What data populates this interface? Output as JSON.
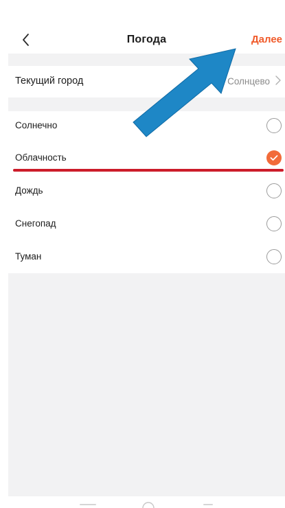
{
  "header": {
    "title": "Погода",
    "next_label": "Далее"
  },
  "city": {
    "label": "Текущий город",
    "value": "Солнцево"
  },
  "options": [
    {
      "label": "Солнечно",
      "checked": false
    },
    {
      "label": "Облачность",
      "checked": true
    },
    {
      "label": "Дождь",
      "checked": false
    },
    {
      "label": "Снегопад",
      "checked": false
    },
    {
      "label": "Туман",
      "checked": false
    }
  ],
  "colors": {
    "accent": "#f05a2a",
    "checked_radio": "#f26b3a",
    "annotation_arrow": "#1e87c6",
    "annotation_underline": "#cc1c2a",
    "background_band": "#f2f2f3"
  },
  "icons": {
    "back": "chevron-left-icon",
    "city_chevron": "chevron-right-icon",
    "check": "check-icon"
  }
}
